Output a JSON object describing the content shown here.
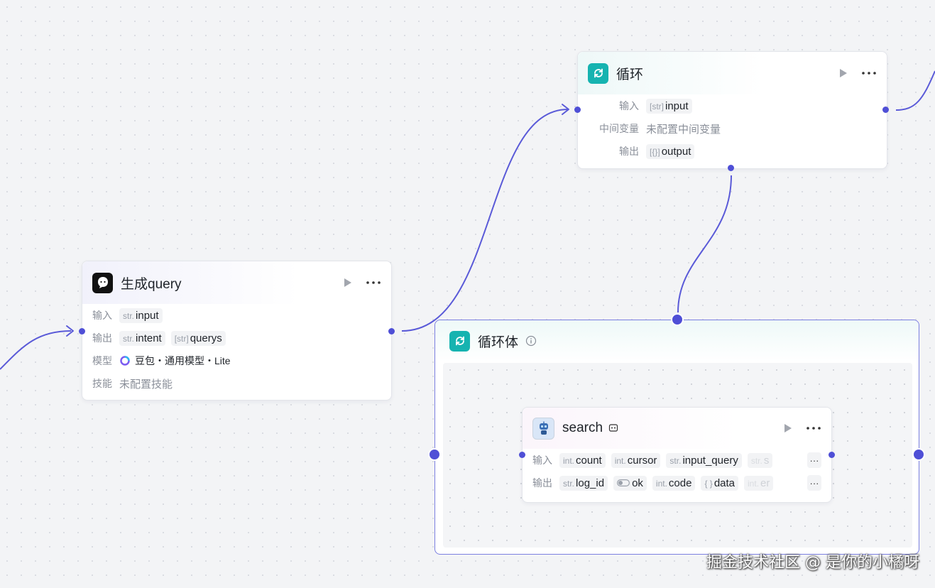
{
  "loop_node": {
    "title": "循环",
    "rows": {
      "input_label": "输入",
      "input_type": "[str]",
      "input_name": "input",
      "vars_label": "中间变量",
      "vars_value": "未配置中间变量",
      "output_label": "输出",
      "output_type": "[{}]",
      "output_name": "output"
    }
  },
  "query_node": {
    "title": "生成query",
    "rows": {
      "input_label": "输入",
      "input_type": "str.",
      "input_name": "input",
      "output_label": "输出",
      "output_1_type": "str.",
      "output_1_name": "intent",
      "output_2_type": "[str]",
      "output_2_name": "querys",
      "model_label": "模型",
      "model_value": "豆包・通用模型・Lite",
      "skill_label": "技能",
      "skill_value": "未配置技能"
    }
  },
  "loop_body": {
    "title": "循环体"
  },
  "search_node": {
    "title": "search",
    "input_label": "输入",
    "inputs": [
      {
        "type": "int.",
        "name": "count"
      },
      {
        "type": "int.",
        "name": "cursor"
      },
      {
        "type": "str.",
        "name": "input_query"
      },
      {
        "type": "str.",
        "name": "s"
      }
    ],
    "output_label": "输出",
    "outputs": [
      {
        "type": "str.",
        "name": "log_id"
      },
      {
        "type": "",
        "name": "ok"
      },
      {
        "type": "int.",
        "name": "code"
      },
      {
        "type": "{ }",
        "name": "data"
      },
      {
        "type": "int.",
        "name": "er"
      }
    ],
    "more": "···"
  },
  "watermark": "掘金技术社区 @ 是你的小橘呀",
  "colors": {
    "edge": "#5a5ad8",
    "teal": "#16b3b0",
    "accent": "#4f4fd6"
  }
}
